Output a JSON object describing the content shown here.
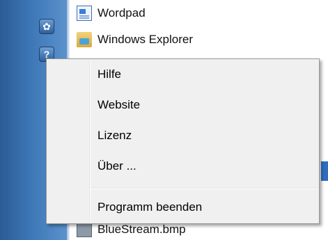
{
  "launcher": {
    "buttons": [
      {
        "icon": "gear-icon",
        "glyph": "✿"
      },
      {
        "icon": "help-icon",
        "glyph": "?"
      }
    ]
  },
  "list": {
    "items": [
      {
        "label": "Wordpad",
        "icon": "wordpad-icon"
      },
      {
        "label": "Windows Explorer",
        "icon": "windows-explorer-icon"
      }
    ],
    "bottom_item": {
      "label": "BlueStream.bmp",
      "icon": "bitmap-file-icon"
    }
  },
  "context_menu": {
    "items": [
      {
        "label": "Hilfe"
      },
      {
        "label": "Website"
      },
      {
        "label": "Lizenz"
      },
      {
        "label": "Über ..."
      }
    ],
    "exit_label": "Programm beenden"
  }
}
